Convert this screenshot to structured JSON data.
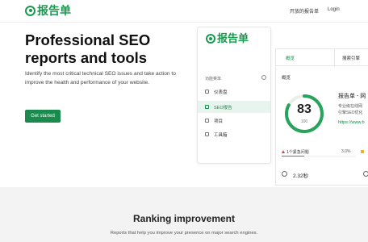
{
  "brand": {
    "name": "报告单",
    "accent": "#1a9a4f"
  },
  "nav": {
    "open_source": "开放的报告单",
    "login": "Login"
  },
  "hero": {
    "title": "Professional SEO reports and tools",
    "subtitle": "Identify the most critical technical SEO issues and take action to improve the health and performance of your website.",
    "cta": "Get started"
  },
  "mock": {
    "brand": "报告单",
    "menu_head": "功能菜单",
    "menu": [
      {
        "label": "仪表盘",
        "icon": "grid-icon"
      },
      {
        "label": "SEO报告",
        "icon": "report-icon"
      },
      {
        "label": "项目",
        "icon": "project-icon"
      },
      {
        "label": "工具箱",
        "icon": "tools-icon"
      }
    ],
    "tabs": {
      "overview": "概览",
      "search": "搜索引擎"
    },
    "section": "概览",
    "score": {
      "value": 83,
      "max": 100,
      "unit": "100"
    },
    "report_title": "报告单 - 网",
    "report_desc_1": "专业级在线网",
    "report_desc_2": "引擎SEO优化",
    "report_link": "https://www.b",
    "issue": {
      "label": "1个紧急问题",
      "pct": "3.0%",
      "fraction": 0.03
    },
    "timing": "2.32秒"
  },
  "lower": {
    "title": "Ranking improvement",
    "subtitle": "Reports that help you improve your presence on major search engines."
  }
}
